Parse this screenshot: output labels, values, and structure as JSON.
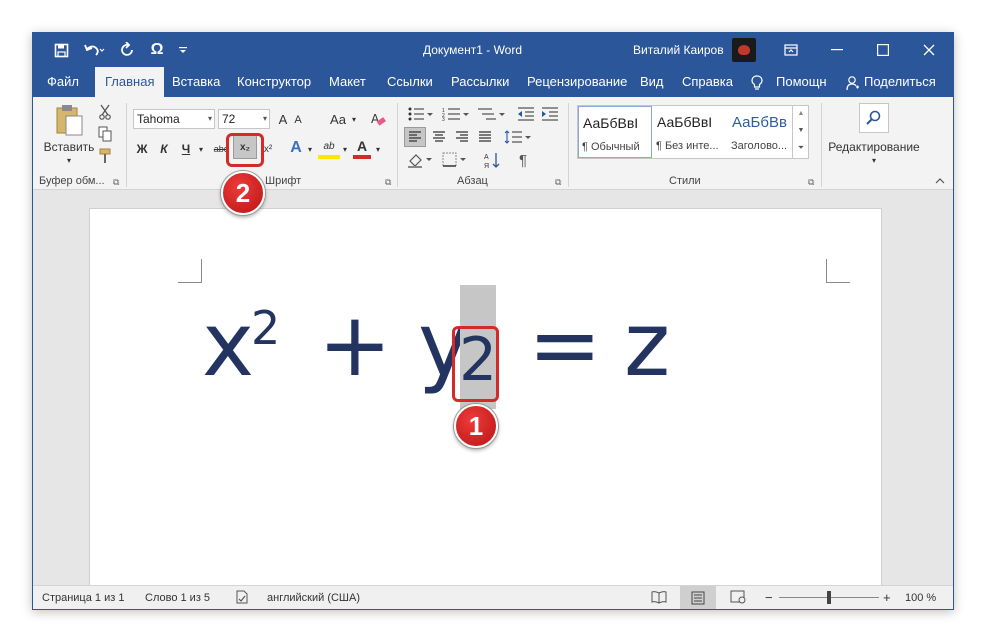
{
  "window": {
    "title": "Документ1  -  Word",
    "user_name": "Виталий Каиров"
  },
  "quick_access": {
    "save_icon": "save-icon",
    "undo_icon": "undo-icon",
    "redo_icon": "redo-icon",
    "omega": "Ω",
    "customize_icon": "customize-icon"
  },
  "tabs": [
    "Файл",
    "Главная",
    "Вставка",
    "Конструктор",
    "Макет",
    "Ссылки",
    "Рассылки",
    "Рецензирование",
    "Вид",
    "Справка",
    "Помощн",
    "Поделиться"
  ],
  "ribbon": {
    "clipboard": {
      "paste_label": "Вставить",
      "group_label": "Буфер обм..."
    },
    "font": {
      "font_name": "Tahoma",
      "font_size": "72",
      "bold": "Ж",
      "italic": "К",
      "underline": "Ч",
      "strike": "abc",
      "subscript": "x₂",
      "superscript": "x²",
      "grow": "A",
      "shrink": "A",
      "case": "Aa",
      "text_effects": "A",
      "highlight": "ab",
      "font_color": "A",
      "group_label": "Шрифт"
    },
    "paragraph": {
      "group_label": "Абзац",
      "pilcrow": "¶"
    },
    "styles": {
      "items": [
        {
          "sample": "АаБбВвІ",
          "name": "¶ Обычный"
        },
        {
          "sample": "АаБбВвІ",
          "name": "¶ Без инте..."
        },
        {
          "sample": "АаБбВв",
          "name": "Заголово..."
        }
      ],
      "group_label": "Стили"
    },
    "editing": {
      "label": "Редактирование"
    }
  },
  "document": {
    "x": "x",
    "sup": "2",
    "plus": "+",
    "y": "y",
    "sub": "2",
    "equals": "=",
    "z": "z"
  },
  "status": {
    "page": "Страница 1 из 1",
    "words": "Слово 1 из 5",
    "language": "английский (США)",
    "zoom": "100 %",
    "minus": "−",
    "plus": "+"
  },
  "callouts": {
    "one": "1",
    "two": "2"
  },
  "colors": {
    "accent": "#2b579a",
    "callout_red": "#d62a2a",
    "formula": "#243461"
  }
}
